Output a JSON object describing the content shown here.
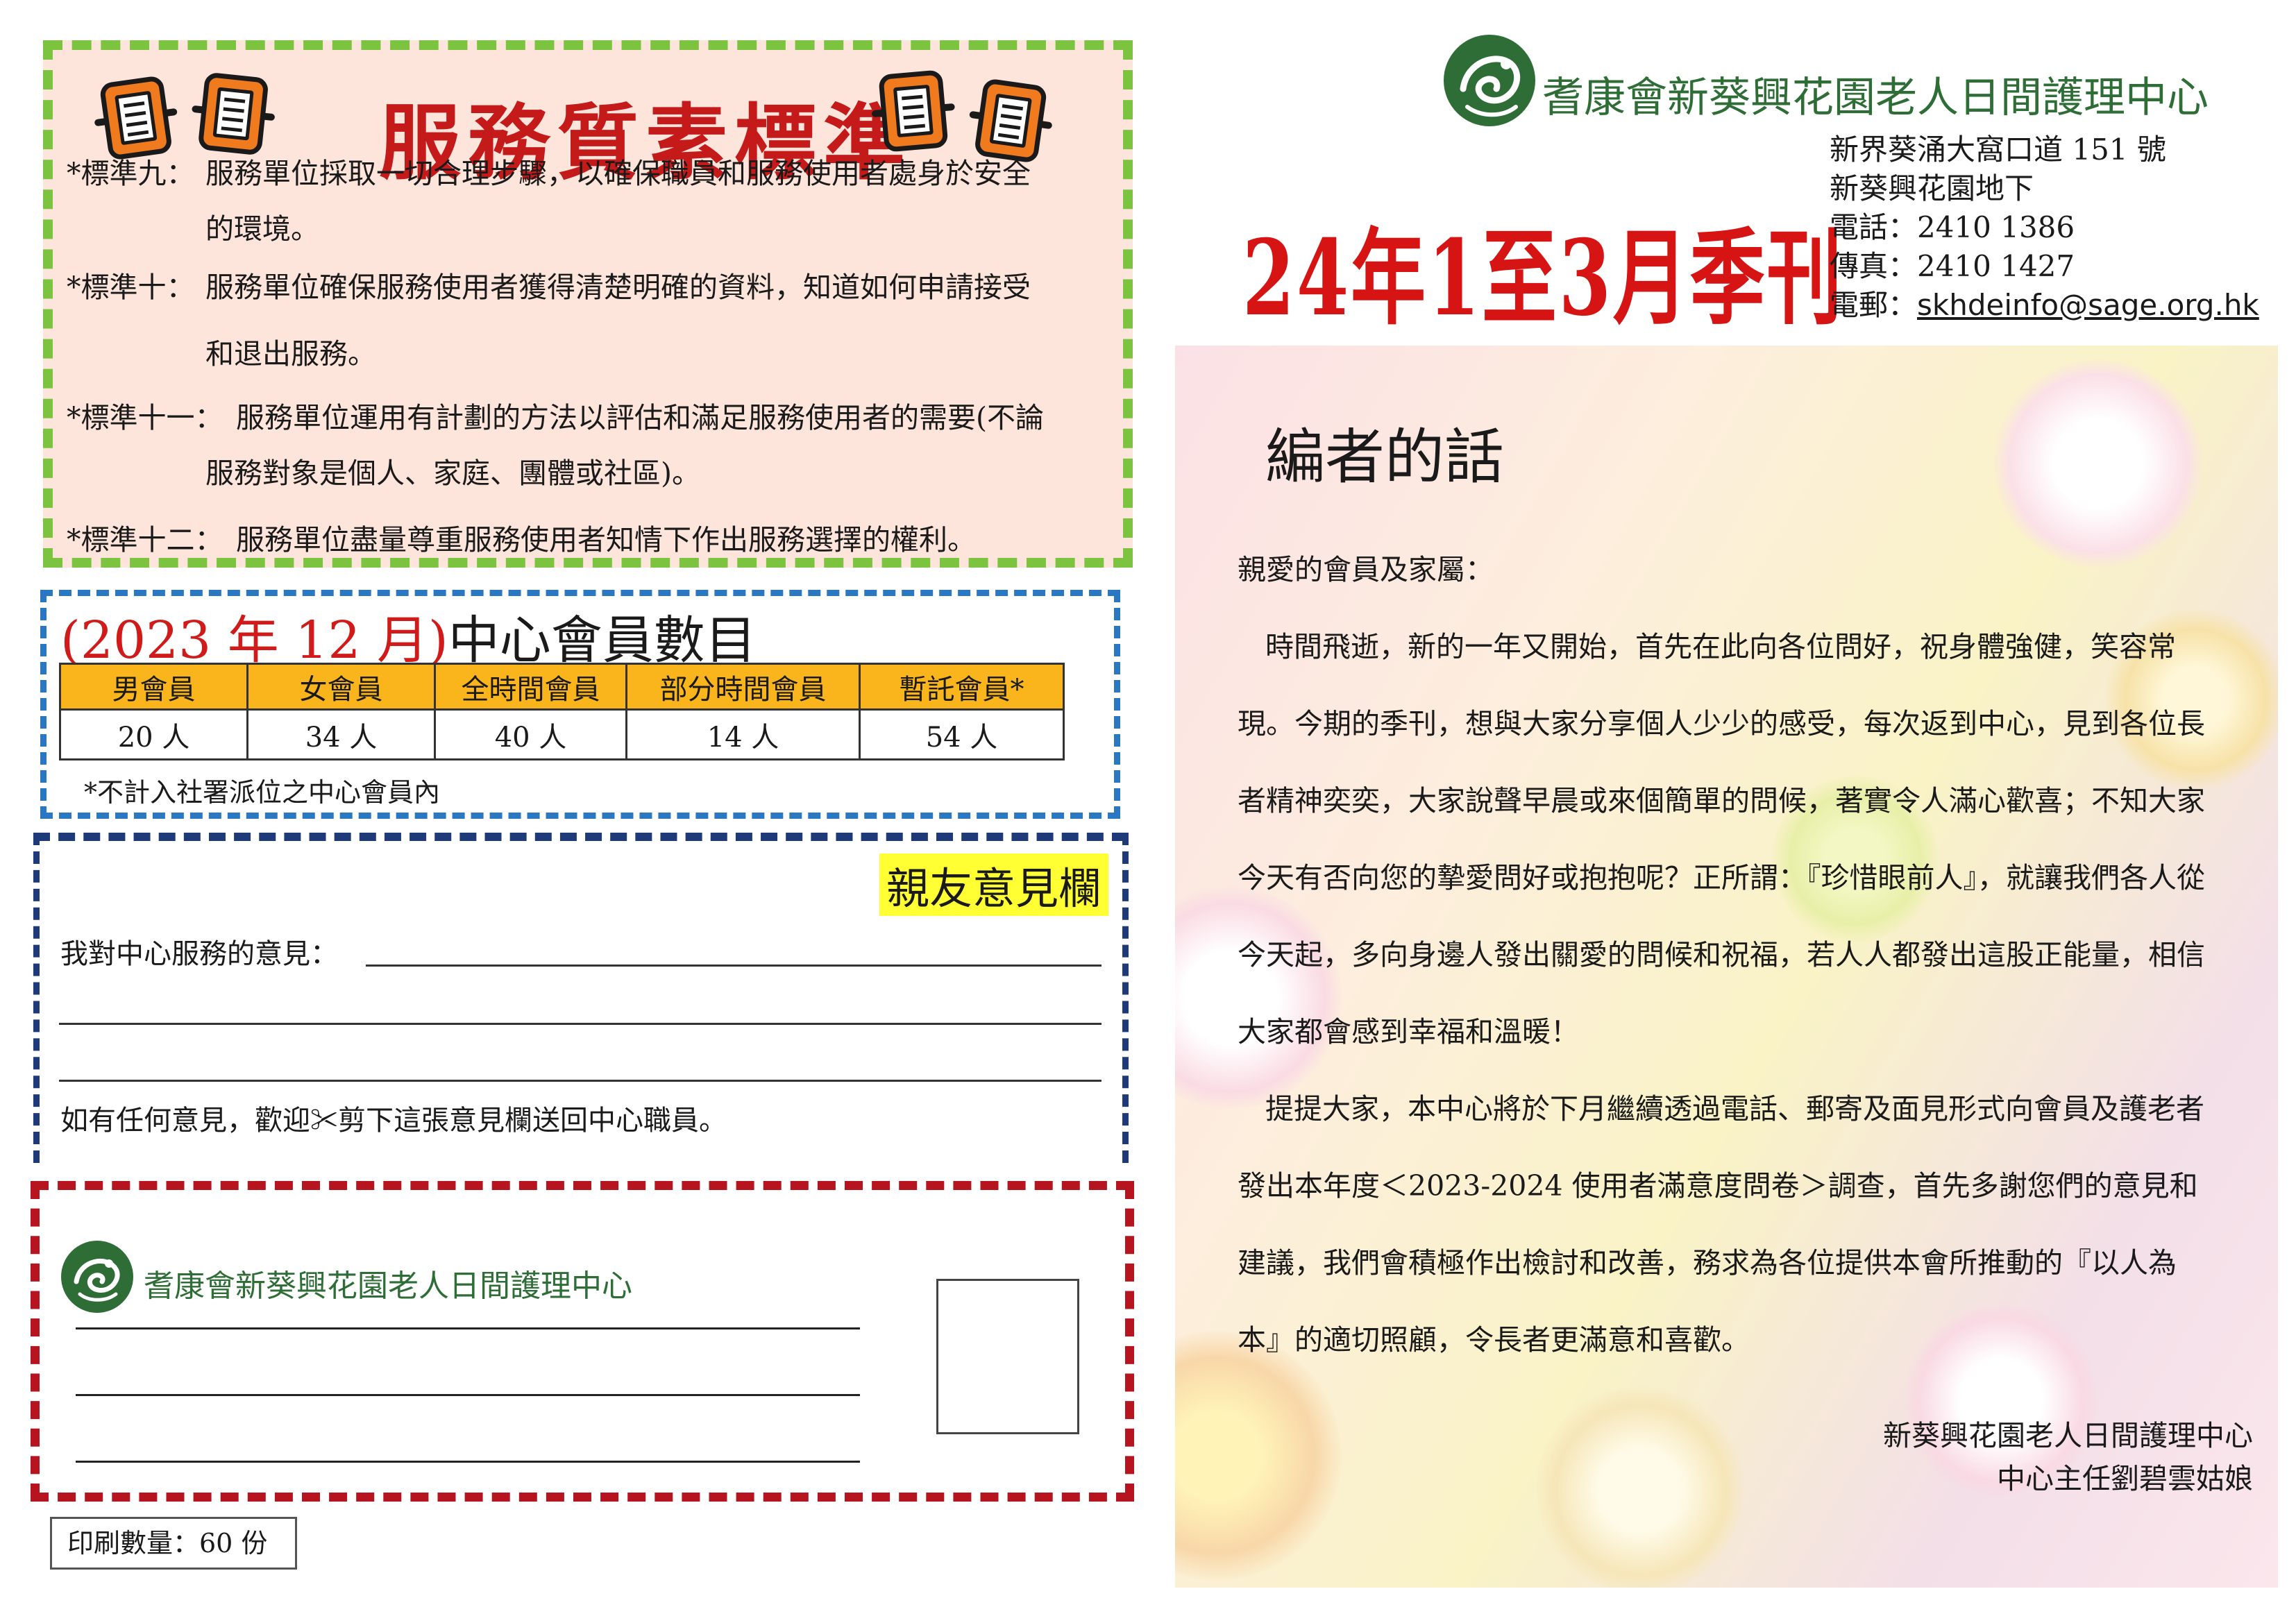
{
  "standards": {
    "title": "服務質素標準",
    "items": [
      {
        "label": "*標準九：",
        "line1": "服務單位採取一切合理步驟，以確保職員和服務使用者處身於安全",
        "line2": "的環境。"
      },
      {
        "label": "*標準十：",
        "line1": "服務單位確保服務使用者獲得清楚明確的資料，知道如何申請接受",
        "line2": "和退出服務。"
      },
      {
        "label": "*標準十一：",
        "line1": "服務單位運用有計劃的方法以評估和滿足服務使用者的需要(不論",
        "line2": "服務對象是個人、家庭、團體或社區)。"
      },
      {
        "label": "*標準十二：",
        "line1": "服務單位盡量尊重服務使用者知情下作出服務選擇的權利。",
        "line2": ""
      }
    ]
  },
  "members": {
    "title_red": "(2023 年 12 月)",
    "title_black": "中心會員數目",
    "headers": [
      "男會員",
      "女會員",
      "全時間會員",
      "部分時間會員",
      "暫託會員*"
    ],
    "values": [
      "20 人",
      "34 人",
      "40 人",
      "14 人",
      "54 人"
    ],
    "note": "*不計入社署派位之中心會員內"
  },
  "feedback": {
    "title": "親友意見欄",
    "label": "我對中心服務的意見：",
    "footer": "如有任何意見，歡迎✂剪下這張意見欄送回中心職員。"
  },
  "mail": {
    "org_name": "耆康會新葵興花園老人日間護理中心"
  },
  "print_qty": "印刷數量：60 份",
  "header": {
    "org_name": "耆康會新葵興花園老人日間護理中心",
    "issue": "24年1至3月季刊",
    "address1": "新界葵涌大窩口道 151 號",
    "address2": "新葵興花園地下",
    "phone": "電話：2410 1386",
    "fax": "傳真：2410 1427",
    "email_label": "電郵：",
    "email": "skhdeinfo@sage.org.hk"
  },
  "editor": {
    "title": "編者的話",
    "greeting": "親愛的會員及家屬：",
    "para1": "時間飛逝，新的一年又開始，首先在此向各位問好，祝身體強健，笑容常現。今期的季刊，想與大家分享個人少少的感受，每次返到中心，見到各位長者精神奕奕，大家說聲早晨或來個簡單的問候，著實令人滿心歡喜；不知大家今天有否向您的摯愛問好或抱抱呢？正所謂：『珍惜眼前人』，就讓我們各人從今天起，多向身邊人發出關愛的問候和祝福，若人人都發出這股正能量，相信大家都會感到幸福和溫暖！",
    "para2": "提提大家，本中心將於下月繼續透過電話、郵寄及面見形式向會員及護老者發出本年度＜2023-2024 使用者滿意度問卷＞調查，首先多謝您們的意見和建議，我們會積極作出檢討和改善，務求為各位提供本會所推動的『以人為本』的適切照顧，令長者更滿意和喜歡。",
    "sign1": "新葵興花園老人日間護理中心",
    "sign2": "中心主任劉碧雲姑娘"
  },
  "colors": {
    "standards_border": "#7cc440",
    "standards_bg": "#fde5dc",
    "title_red": "#c51a1a",
    "member_border": "#2b78c2",
    "table_header": "#f9b51b",
    "feedback_border": "#1f3a78",
    "feedback_highlight": "#ffff33",
    "mail_border": "#b6141e",
    "org_green": "#2e6e36"
  },
  "icons": [
    "document-mascot-icon",
    "sage-logo-icon"
  ]
}
